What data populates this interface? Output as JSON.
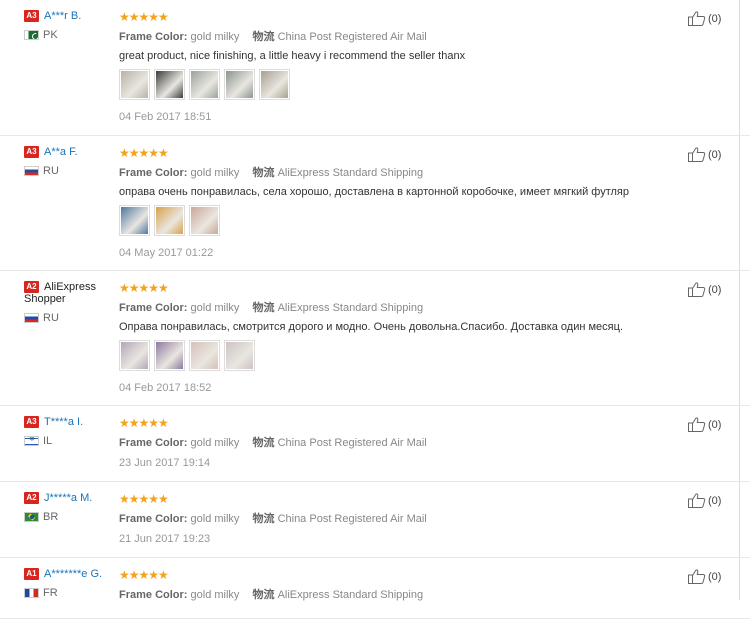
{
  "attr_label": "Frame Color:",
  "shipping_label": "物流",
  "reviews": [
    {
      "badge": "A3",
      "name": "A***r B.",
      "country": "PK",
      "flag": "pk",
      "stars": "★★★★★",
      "color": "gold milky",
      "shipping": "China Post Registered Air Mail",
      "text": "great product, nice finishing, a little heavy i recommend the seller thanx",
      "date": "04 Feb 2017 18:51",
      "likes": "(0)",
      "photos": [
        "#b8b2a6",
        "#3a3d3c",
        "#9aa39b",
        "#8d9490",
        "#a89f8f"
      ]
    },
    {
      "badge": "A3",
      "name": "A**a F.",
      "country": "RU",
      "flag": "ru",
      "stars": "★★★★★",
      "color": "gold milky",
      "shipping": "AliExpress Standard Shipping",
      "text": "оправа очень понравилась, села хорошо, доставлена в картонной коробочке, имеет мягкий футляр",
      "date": "04 May 2017 01:22",
      "likes": "(0)",
      "photos": [
        "#4f78a1",
        "#d8a24a",
        "#c9a79b"
      ]
    },
    {
      "badge": "A2",
      "name": "AliExpress Shopper",
      "country": "RU",
      "flag": "ru",
      "stars": "★★★★★",
      "color": "gold milky",
      "shipping": "AliExpress Standard Shipping",
      "text": "Оправа понравилась, смотрится дорого и модно. Очень довольна.Спасибо. Доставка один месяц.",
      "date": "04 Feb 2017 18:52",
      "likes": "(0)",
      "photos": [
        "#b3a6b9",
        "#8e7aa1",
        "#d5c0b8",
        "#cfc3c3"
      ]
    },
    {
      "badge": "A3",
      "name": "T****a I.",
      "country": "IL",
      "flag": "il",
      "stars": "★★★★★",
      "color": "gold milky",
      "shipping": "China Post Registered Air Mail",
      "text": "",
      "date": "23 Jun 2017 19:14",
      "likes": "(0)",
      "photos": []
    },
    {
      "badge": "A2",
      "name": "J*****a M.",
      "country": "BR",
      "flag": "br",
      "stars": "★★★★★",
      "color": "gold milky",
      "shipping": "China Post Registered Air Mail",
      "text": "",
      "date": "21 Jun 2017 19:23",
      "likes": "(0)",
      "photos": []
    },
    {
      "badge": "A1",
      "name": "A*******e G.",
      "country": "FR",
      "flag": "fr",
      "stars": "★★★★★",
      "color": "gold milky",
      "shipping": "AliExpress Standard Shipping",
      "text": "",
      "date": "",
      "likes": "(0)",
      "photos": []
    }
  ]
}
